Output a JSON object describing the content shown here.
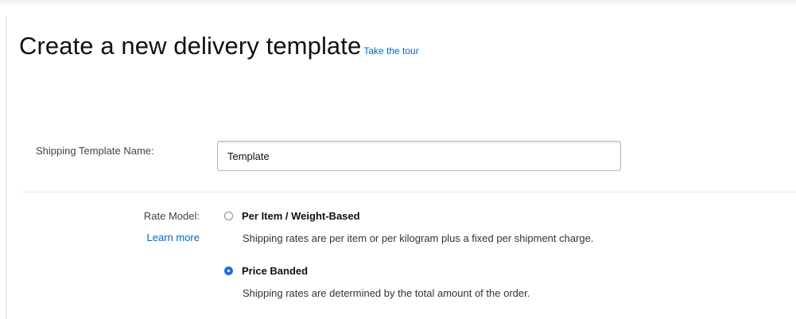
{
  "page": {
    "title": "Create a new delivery template",
    "tour_link": "Take the tour"
  },
  "template_name": {
    "label": "Shipping Template Name:",
    "value": "Template"
  },
  "rate_model": {
    "label": "Rate Model:",
    "learn_more": "Learn more",
    "options": [
      {
        "label": "Per Item / Weight-Based",
        "description": "Shipping rates are per item or per kilogram plus a fixed per shipment charge.",
        "selected": false
      },
      {
        "label": "Price Banded",
        "description": "Shipping rates are determined by the total amount of the order.",
        "selected": true
      }
    ]
  },
  "colors": {
    "link": "#0066c0",
    "radio_selected": "#1f6fd1"
  }
}
